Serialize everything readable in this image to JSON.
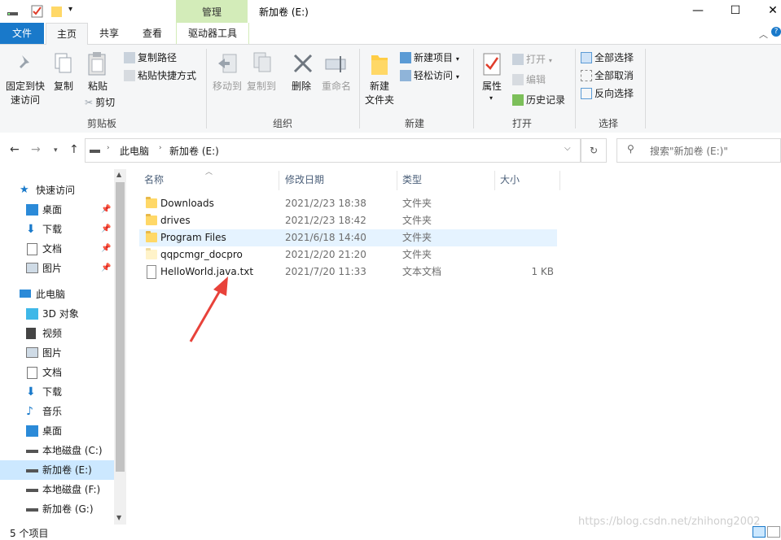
{
  "window": {
    "title": "新加卷 (E:)",
    "context_tab": "管理",
    "controls": {
      "minimize": "—",
      "maximize": "☐",
      "close": "✕"
    }
  },
  "ribbon_tabs": [
    "文件",
    "主页",
    "共享",
    "查看",
    "驱动器工具"
  ],
  "ribbon": {
    "clipboard": {
      "label": "剪贴板",
      "pin": "固定到快速访问",
      "pin_l1": "固定到快",
      "pin_l2": "速访问",
      "copy": "复制",
      "paste": "粘贴",
      "copy_path": "复制路径",
      "paste_shortcut": "粘贴快捷方式",
      "cut": "剪切"
    },
    "organize": {
      "label": "组织",
      "move_to": "移动到",
      "copy_to": "复制到",
      "delete": "删除",
      "rename": "重命名"
    },
    "new": {
      "label": "新建",
      "new_folder_l1": "新建",
      "new_folder_l2": "文件夹",
      "new_item": "新建项目",
      "easy_access": "轻松访问"
    },
    "open": {
      "label": "打开",
      "properties": "属性",
      "open": "打开",
      "edit": "编辑",
      "history": "历史记录"
    },
    "select": {
      "label": "选择",
      "select_all": "全部选择",
      "select_none": "全部取消",
      "invert": "反向选择"
    }
  },
  "address": {
    "crumbs": [
      "此电脑",
      "新加卷 (E:)"
    ],
    "search_placeholder": "搜索\"新加卷 (E:)\""
  },
  "nav": {
    "quick_access": "快速访问",
    "quick_items": [
      "桌面",
      "下载",
      "文档",
      "图片"
    ],
    "this_pc": "此电脑",
    "pc_items": [
      "3D 对象",
      "视频",
      "图片",
      "文档",
      "下载",
      "音乐",
      "桌面",
      "本地磁盘 (C:)",
      "新加卷 (E:)",
      "本地磁盘 (F:)",
      "新加卷 (G:)"
    ]
  },
  "columns": {
    "name": "名称",
    "modified": "修改日期",
    "type": "类型",
    "size": "大小"
  },
  "files": [
    {
      "name": "Downloads",
      "modified": "2021/2/23 18:38",
      "type": "文件夹",
      "size": ""
    },
    {
      "name": "drives",
      "modified": "2021/2/23 18:42",
      "type": "文件夹",
      "size": ""
    },
    {
      "name": "Program Files",
      "modified": "2021/6/18 14:40",
      "type": "文件夹",
      "size": ""
    },
    {
      "name": "qqpcmgr_docpro",
      "modified": "2021/2/20 21:20",
      "type": "文件夹",
      "size": ""
    },
    {
      "name": "HelloWorld.java.txt",
      "modified": "2021/7/20 11:33",
      "type": "文本文档",
      "size": "1 KB"
    }
  ],
  "status": {
    "item_count": "5 个项目"
  },
  "watermark": "https://blog.csdn.net/zhihong2002"
}
